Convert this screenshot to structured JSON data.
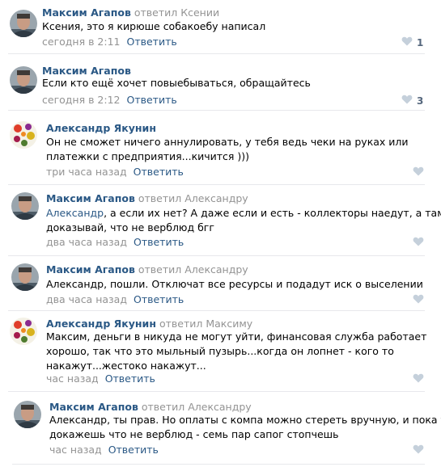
{
  "comments": [
    {
      "author": "Максим Агапов",
      "reply_word": "ответил",
      "reply_to": "Ксении",
      "addressee": "",
      "lines": [
        "Ксения, это я кирюше собакоебу написал"
      ],
      "time": "сегодня в 2:11",
      "reply_label": "Ответить",
      "likes": "1",
      "avatar": "person-photo"
    },
    {
      "author": "Максим Агапов",
      "reply_word": "",
      "reply_to": "",
      "addressee": "",
      "lines": [
        "Если кто ещё хочет повыебываться, обращайтесь"
      ],
      "time": "сегодня в 2:12",
      "reply_label": "Ответить",
      "likes": "3",
      "avatar": "person-photo"
    },
    {
      "author": "Александр Якунин",
      "reply_word": "",
      "reply_to": "",
      "addressee": "",
      "lines": [
        "Он не сможет ничего аннулировать, у тебя ведь чеки на руках или",
        "платежки с предприятия...кичится )))"
      ],
      "time": "три часа назад",
      "reply_label": "Ответить",
      "likes": "",
      "avatar": "flowers-photo"
    },
    {
      "author": "Максим Агапов",
      "reply_word": "ответил",
      "reply_to": "Александру",
      "addressee": "Александр",
      "lines": [
        ", а если их нет? А даже если и есть - коллекторы наедут, а там",
        "доказывай, что не верблюд бгг"
      ],
      "time": "два часа назад",
      "reply_label": "Ответить",
      "likes": "",
      "avatar": "person-photo"
    },
    {
      "author": "Максим Агапов",
      "reply_word": "ответил",
      "reply_to": "Александру",
      "addressee": "",
      "lines": [
        "Александр, пошли. Отключат все ресурсы и подадут иск о выселении"
      ],
      "time": "два часа назад",
      "reply_label": "Ответить",
      "likes": "",
      "avatar": "person-photo"
    },
    {
      "author": "Александр Якунин",
      "reply_word": "ответил",
      "reply_to": "Максиму",
      "addressee": "",
      "lines": [
        "Максим, деньги в никуда не могут уйти, финансовая служба работает",
        "хорошо, так что это мыльный пузырь...когда он лопнет - кого то",
        "накажут...жестоко накажут..."
      ],
      "time": "час назад",
      "reply_label": "Ответить",
      "likes": "",
      "avatar": "flowers-photo"
    },
    {
      "author": "Максим Агапов",
      "reply_word": "ответил",
      "reply_to": "Александру",
      "addressee": "",
      "lines": [
        "Александр, ты прав. Но оплаты с компа можно стереть вручную, и пока ты",
        "докажешь что не верблюд - семь пар сапог стопчешь"
      ],
      "time": "час назад",
      "reply_label": "Ответить",
      "likes": "",
      "avatar": "person-photo"
    }
  ]
}
